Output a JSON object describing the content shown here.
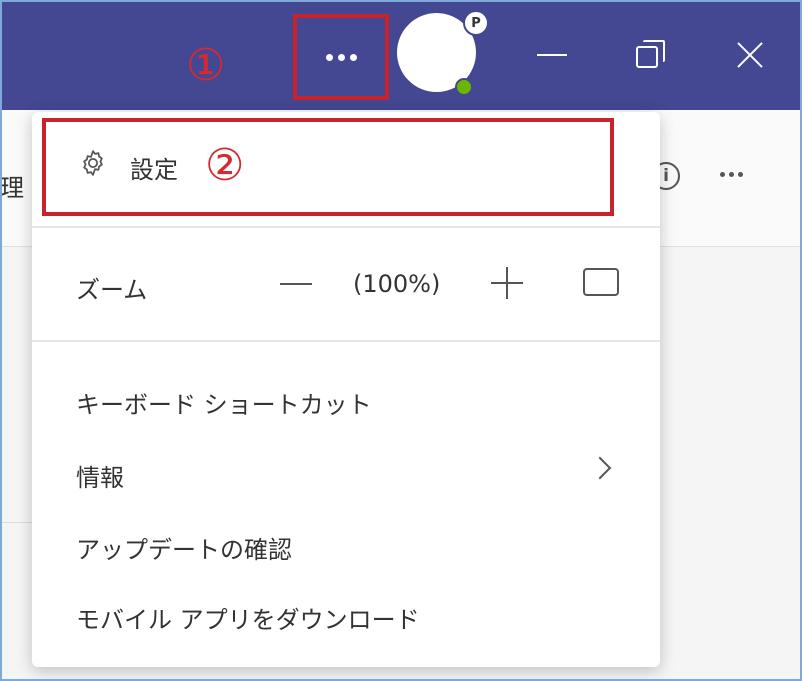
{
  "annotations": {
    "step1": "①",
    "step2": "②"
  },
  "titlebar": {
    "avatar_badge": "P",
    "icons": [
      "more-icon",
      "minimize-icon",
      "restore-icon",
      "close-icon"
    ]
  },
  "background": {
    "left_text": "理"
  },
  "menu": {
    "settings_label": "設定",
    "zoom": {
      "label": "ズーム",
      "value": "(100%)"
    },
    "items": [
      {
        "label": "キーボード ショートカット"
      },
      {
        "label": "情報"
      },
      {
        "label": "アップデートの確認"
      },
      {
        "label": "モバイル アプリをダウンロード"
      }
    ]
  },
  "colors": {
    "titlebar": "#444791",
    "highlight": "#c8232c",
    "presence": "#6bb700"
  }
}
